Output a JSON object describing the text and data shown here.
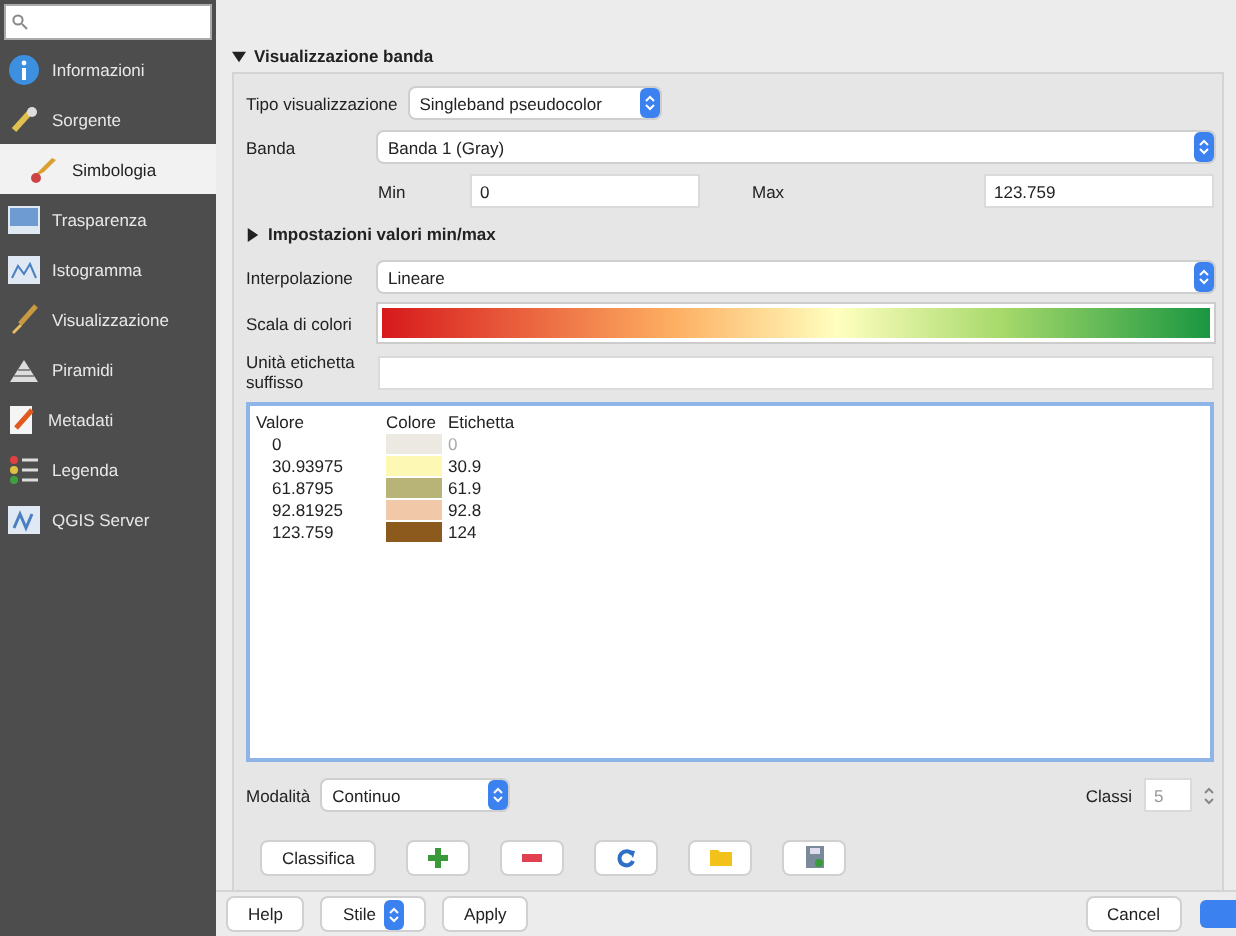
{
  "sidebar": {
    "items": [
      {
        "label": "Informazioni",
        "selected": false
      },
      {
        "label": "Sorgente",
        "selected": false
      },
      {
        "label": "Simbologia",
        "selected": true
      },
      {
        "label": "Trasparenza",
        "selected": false
      },
      {
        "label": "Istogramma",
        "selected": false
      },
      {
        "label": "Visualizzazione",
        "selected": false
      },
      {
        "label": "Piramidi",
        "selected": false
      },
      {
        "label": "Metadati",
        "selected": false
      },
      {
        "label": "Legenda",
        "selected": false
      },
      {
        "label": "QGIS Server",
        "selected": false
      }
    ]
  },
  "section": {
    "title": "Visualizzazione banda",
    "expanded": true
  },
  "render_type": {
    "label": "Tipo visualizzazione",
    "value": "Singleband pseudocolor"
  },
  "band": {
    "label": "Banda",
    "value": "Banda 1 (Gray)"
  },
  "min": {
    "label": "Min",
    "value": "0"
  },
  "max": {
    "label": "Max",
    "value": "123.759"
  },
  "minmax_settings": {
    "title": "Impostazioni valori min/max",
    "expanded": false
  },
  "interpolation": {
    "label": "Interpolazione",
    "value": "Lineare"
  },
  "color_ramp": {
    "label": "Scala di colori"
  },
  "suffix": {
    "label": "Unità etichetta suffisso"
  },
  "table": {
    "columns": [
      "Valore",
      "Colore",
      "Etichetta"
    ],
    "rows": [
      {
        "value": "0",
        "color": "#ebe9e2",
        "label": "0",
        "disabled": true
      },
      {
        "value": "30.93975",
        "color": "#fdf8b4",
        "label": "30.9",
        "disabled": false
      },
      {
        "value": "61.8795",
        "color": "#b8b478",
        "label": "61.9",
        "disabled": false
      },
      {
        "value": "92.81925",
        "color": "#f1c8a8",
        "label": "92.8",
        "disabled": false
      },
      {
        "value": "123.759",
        "color": "#8b5a1c",
        "label": "124",
        "disabled": false
      }
    ]
  },
  "mode": {
    "label": "Modalità",
    "value": "Continuo"
  },
  "classes": {
    "label": "Classi",
    "value": "5"
  },
  "classify_button": "Classifica",
  "tool_buttons": [
    {
      "kind": "add"
    },
    {
      "kind": "remove"
    },
    {
      "kind": "refresh"
    },
    {
      "kind": "folder"
    },
    {
      "kind": "save"
    }
  ],
  "footer": {
    "help": "Help",
    "style": "Stile",
    "apply": "Apply",
    "cancel": "Cancel"
  }
}
